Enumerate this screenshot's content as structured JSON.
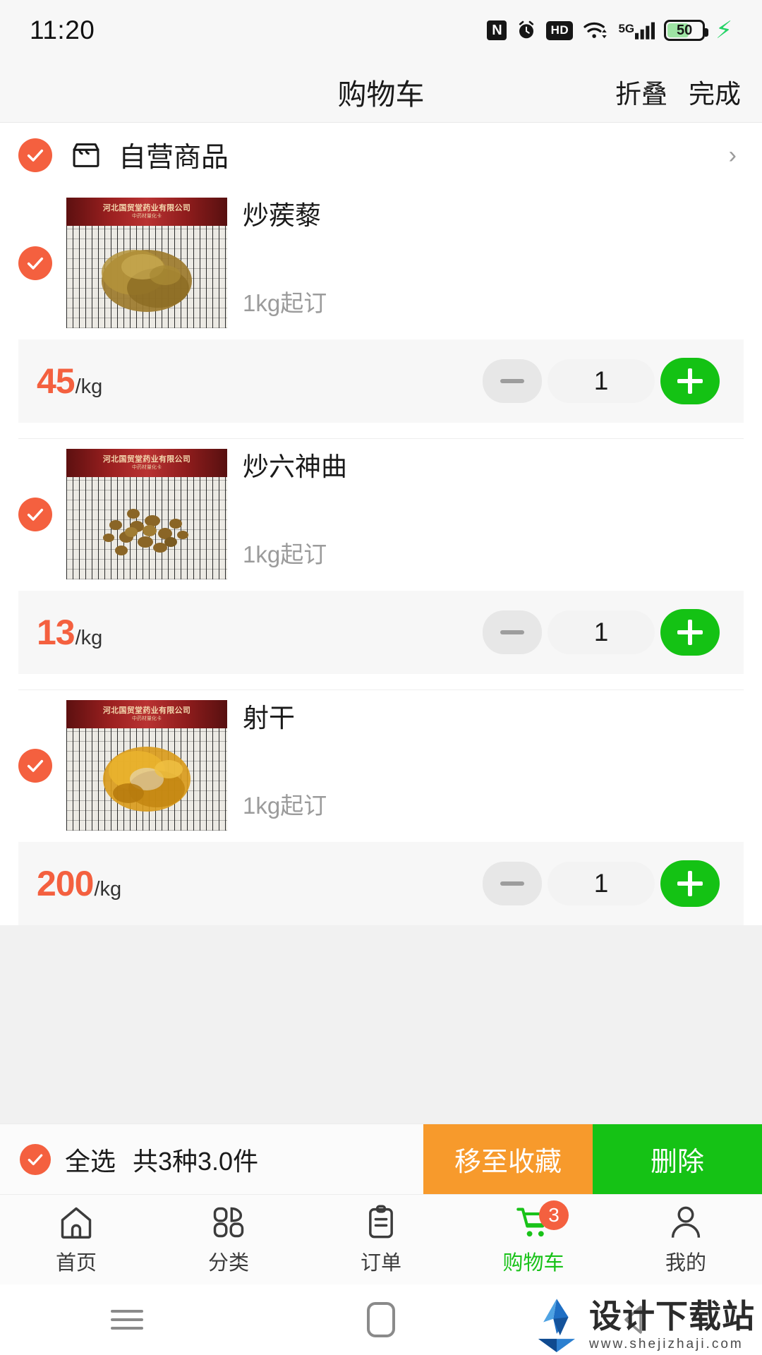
{
  "status_bar": {
    "time": "11:20",
    "battery_level": "50",
    "network": "5G",
    "icons": [
      "nfc-icon",
      "alarm-icon",
      "hd-icon",
      "wifi-icon",
      "signal-icon",
      "battery-icon",
      "charging-bolt-icon"
    ]
  },
  "header": {
    "title": "购物车",
    "action_collapse": "折叠",
    "action_done": "完成"
  },
  "store": {
    "name": "自营商品",
    "checked": true,
    "chevron": "›"
  },
  "products": [
    {
      "name": "炒蒺藜",
      "min_order": "1kg起订",
      "price": "45",
      "unit": "/kg",
      "qty": "1",
      "checked": true,
      "minus_label": "−",
      "plus_label": "+",
      "image_banner": "河北国贸堂药业有限公司",
      "image_subbanner": "中药材量化卡"
    },
    {
      "name": "炒六神曲",
      "min_order": "1kg起订",
      "price": "13",
      "unit": "/kg",
      "qty": "1",
      "checked": true,
      "minus_label": "−",
      "plus_label": "+",
      "image_banner": "河北国贸堂药业有限公司",
      "image_subbanner": "中药材量化卡"
    },
    {
      "name": "射干",
      "min_order": "1kg起订",
      "price": "200",
      "unit": "/kg",
      "qty": "1",
      "checked": true,
      "minus_label": "−",
      "plus_label": "+",
      "image_banner": "河北国贸堂药业有限公司",
      "image_subbanner": "中药材量化卡"
    }
  ],
  "action_bar": {
    "select_all_label": "全选",
    "summary": "共3种3.0件",
    "move_to_favorites": "移至收藏",
    "delete": "删除",
    "select_all_checked": true
  },
  "tab_bar": {
    "tabs": [
      {
        "label": "首页",
        "icon": "home-icon",
        "active": false
      },
      {
        "label": "分类",
        "icon": "grid-icon",
        "active": false
      },
      {
        "label": "订单",
        "icon": "clipboard-icon",
        "active": false
      },
      {
        "label": "购物车",
        "icon": "cart-icon",
        "active": true,
        "badge": "3"
      },
      {
        "label": "我的",
        "icon": "person-icon",
        "active": false
      }
    ]
  },
  "nav_bar": {
    "recents": "recents-icon",
    "home": "home-square-icon",
    "back": "back-triangle-icon"
  },
  "watermark": {
    "name": "设计下载站",
    "url": "www.shejizhaji.com"
  },
  "colors": {
    "accent_orange": "#f4603f",
    "green": "#14c214",
    "fav_orange": "#f79a2c",
    "price_orange": "#f4603f"
  }
}
